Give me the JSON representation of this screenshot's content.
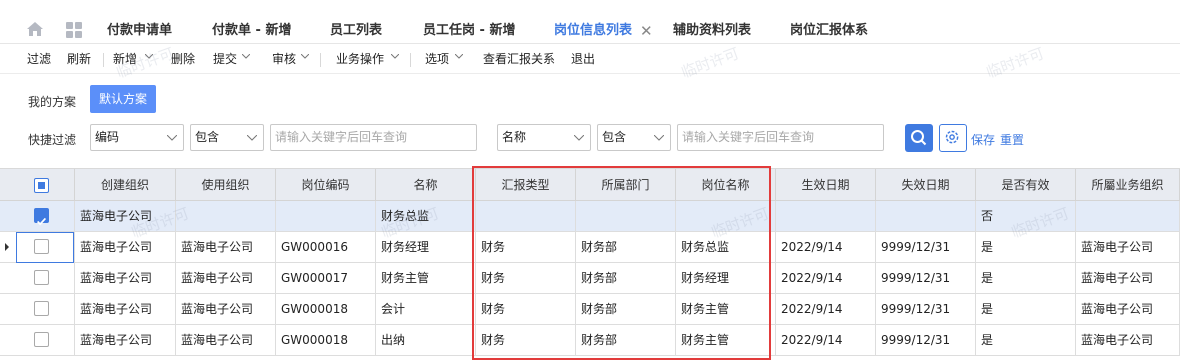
{
  "tabs": [
    {
      "label": "付款申请单"
    },
    {
      "label": "付款单 - 新增"
    },
    {
      "label": "员工列表"
    },
    {
      "label": "员工任岗 - 新增"
    },
    {
      "label": "岗位信息列表"
    },
    {
      "label": "辅助资料列表"
    },
    {
      "label": "岗位汇报体系"
    }
  ],
  "toolbar": {
    "filter": "过滤",
    "refresh": "刷新",
    "add": "新增",
    "delete": "删除",
    "submit": "提交",
    "audit": "审核",
    "business": "业务操作",
    "options": "选项",
    "view_report": "查看汇报关系",
    "exit": "退出"
  },
  "filter": {
    "my_schemes": "我的方案",
    "default_scheme": "默认方案",
    "quick_filter": "快捷过滤",
    "field1": "编码",
    "op1": "包含",
    "placeholder": "请输入关键字后回车查询",
    "field2": "名称",
    "op2": "包含",
    "save": "保存",
    "reset": "重置"
  },
  "watermark": "临时许可",
  "table": {
    "columns": [
      "创建组织",
      "使用组织",
      "岗位编码",
      "名称",
      "汇报类型",
      "所属部门",
      "岗位名称",
      "生效日期",
      "失效日期",
      "是否有效",
      "所屬业务组织"
    ],
    "rows": [
      {
        "selected": true,
        "cells": [
          "蓝海电子公司",
          "",
          "",
          "财务总监",
          "",
          "",
          "",
          "",
          "",
          "否",
          ""
        ]
      },
      {
        "selected": false,
        "cells": [
          "蓝海电子公司",
          "蓝海电子公司",
          "GW000016",
          "财务经理",
          "财务",
          "财务部",
          "财务总监",
          "2022/9/14",
          "9999/12/31",
          "是",
          "蓝海电子公司"
        ]
      },
      {
        "selected": false,
        "cells": [
          "蓝海电子公司",
          "蓝海电子公司",
          "GW000017",
          "财务主管",
          "财务",
          "财务部",
          "财务经理",
          "2022/9/14",
          "9999/12/31",
          "是",
          "蓝海电子公司"
        ]
      },
      {
        "selected": false,
        "cells": [
          "蓝海电子公司",
          "蓝海电子公司",
          "GW000018",
          "会计",
          "财务",
          "财务部",
          "财务主管",
          "2022/9/14",
          "9999/12/31",
          "是",
          "蓝海电子公司"
        ]
      },
      {
        "selected": false,
        "cells": [
          "蓝海电子公司",
          "蓝海电子公司",
          "GW000018",
          "出纳",
          "财务",
          "财务部",
          "财务主管",
          "2022/9/14",
          "9999/12/31",
          "是",
          "蓝海电子公司"
        ]
      }
    ]
  },
  "colors": {
    "accent": "#3f7ae0",
    "header_bg": "#e8ebf1",
    "selected_row": "#e3ebf8",
    "highlight": "#e23b3b"
  }
}
